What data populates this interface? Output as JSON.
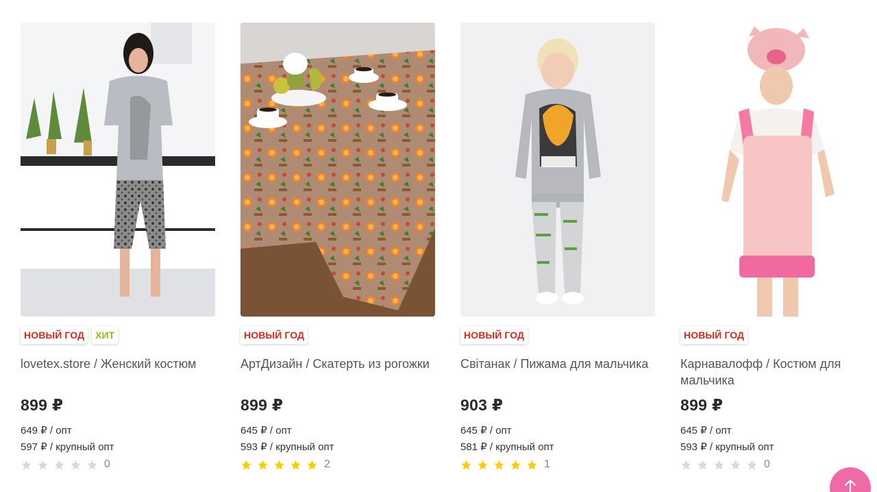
{
  "products": [
    {
      "badges": [
        {
          "label": "НОВЫЙ ГОД",
          "kind": "ny"
        },
        {
          "label": "ХИТ",
          "kind": "hit"
        }
      ],
      "title": "lovetex.store / Женский костюм",
      "price": "899 ₽",
      "wholesale": "649 ₽ / опт",
      "bulk": "597 ₽ / крупный опт",
      "rating": 0,
      "reviews": "0",
      "image": "woman-costume-photo"
    },
    {
      "badges": [
        {
          "label": "НОВЫЙ ГОД",
          "kind": "ny"
        }
      ],
      "title": "АртДизайн / Скатерть из рогожки",
      "price": "899 ₽",
      "wholesale": "645 ₽ / опт",
      "bulk": "593 ₽ / крупный опт",
      "rating": 5,
      "reviews": "2",
      "image": "tablecloth-photo"
    },
    {
      "badges": [
        {
          "label": "НОВЫЙ ГОД",
          "kind": "ny"
        }
      ],
      "title": "Світанак / Пижама для мальчика",
      "price": "903 ₽",
      "wholesale": "645 ₽ / опт",
      "bulk": "581 ₽ / крупный опт",
      "rating": 5,
      "reviews": "1",
      "image": "boy-pajama-photo"
    },
    {
      "badges": [
        {
          "label": "НОВЫЙ ГОД",
          "kind": "ny"
        }
      ],
      "title": "Карнавалофф / Костюм для мальчика",
      "price": "899 ₽",
      "wholesale": "645 ₽ / опт",
      "bulk": "593 ₽ / крупный опт",
      "rating": 0,
      "reviews": "0",
      "image": "boy-pig-costume-photo"
    }
  ],
  "colors": {
    "badge_new_year": "#d42c1c",
    "badge_hit": "#8dbf14",
    "star_on": "#ffcc00",
    "star_off": "#d9d9d9",
    "scroll_top_button": "#f06aa8"
  },
  "scroll_top_icon": "arrow-up-icon"
}
